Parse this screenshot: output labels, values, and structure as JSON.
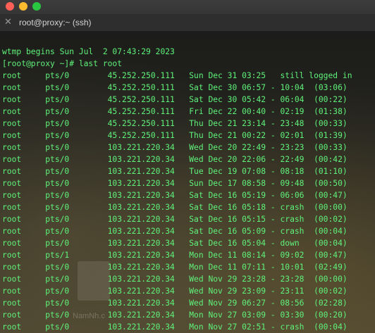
{
  "window": {
    "title": "root@proxy:~ (ssh)"
  },
  "watermark": "NamNh.c",
  "terminal": {
    "lines": [
      "wtmp begins Sun Jul  2 07:43:29 2023",
      "[root@proxy ~]# last root",
      "root     pts/0        45.252.250.111   Sun Dec 31 03:25   still logged in",
      "root     pts/0        45.252.250.111   Sat Dec 30 06:57 - 10:04  (03:06)",
      "root     pts/0        45.252.250.111   Sat Dec 30 05:42 - 06:04  (00:22)",
      "root     pts/0        45.252.250.111   Fri Dec 22 00:40 - 02:19  (01:38)",
      "root     pts/0        45.252.250.111   Thu Dec 21 23:14 - 23:48  (00:33)",
      "root     pts/0        45.252.250.111   Thu Dec 21 00:22 - 02:01  (01:39)",
      "root     pts/0        103.221.220.34   Wed Dec 20 22:49 - 23:23  (00:33)",
      "root     pts/0        103.221.220.34   Wed Dec 20 22:06 - 22:49  (00:42)",
      "root     pts/0        103.221.220.34   Tue Dec 19 07:08 - 08:18  (01:10)",
      "root     pts/0        103.221.220.34   Sun Dec 17 08:58 - 09:48  (00:50)",
      "root     pts/0        103.221.220.34   Sat Dec 16 05:19 - 06:06  (00:47)",
      "root     pts/0        103.221.220.34   Sat Dec 16 05:18 - crash  (00:00)",
      "root     pts/0        103.221.220.34   Sat Dec 16 05:15 - crash  (00:02)",
      "root     pts/0        103.221.220.34   Sat Dec 16 05:09 - crash  (00:04)",
      "root     pts/0        103.221.220.34   Sat Dec 16 05:04 - down   (00:04)",
      "root     pts/1        103.221.220.34   Mon Dec 11 08:14 - 09:02  (00:47)",
      "root     pts/0        103.221.220.34   Mon Dec 11 07:11 - 10:01  (02:49)",
      "root     pts/0        103.221.220.34   Wed Nov 29 23:28 - 23:28  (00:00)",
      "root     pts/0        103.221.220.34   Wed Nov 29 23:09 - 23:11  (00:02)",
      "root     pts/0        103.221.220.34   Wed Nov 29 06:27 - 08:56  (02:28)",
      "root     pts/0        103.221.220.34   Mon Nov 27 03:09 - 03:30  (00:20)",
      "root     pts/0        103.221.220.34   Mon Nov 27 02:51 - crash  (00:04)"
    ]
  },
  "colors": {
    "terminal_text": "#5ff27a",
    "titlebar": "#3d3d3d"
  }
}
